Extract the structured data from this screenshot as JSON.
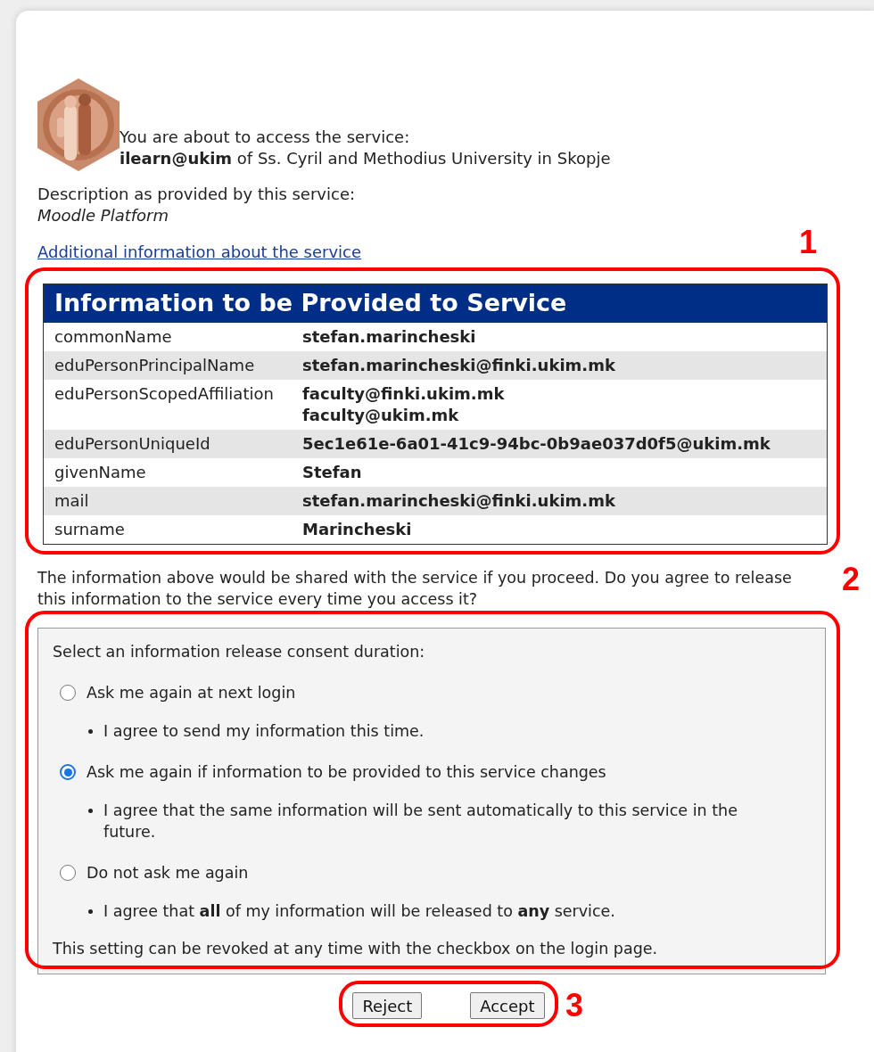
{
  "service": {
    "intro": "You are about to access the service:",
    "name_line": "**ilearn@ukim** of Ss. Cyril and Methodius University in Skopje",
    "description_label": "Description as provided by this service:",
    "description": "Moodle Platform",
    "info_link": "Additional information about the service"
  },
  "attributes": {
    "title": "Information to be Provided to Service",
    "rows": [
      {
        "name": "commonName",
        "values": [
          "stefan.marincheski"
        ]
      },
      {
        "name": "eduPersonPrincipalName",
        "values": [
          "stefan.marincheski@finki.ukim.mk"
        ]
      },
      {
        "name": "eduPersonScopedAffiliation",
        "values": [
          "faculty@finki.ukim.mk",
          "faculty@ukim.mk"
        ]
      },
      {
        "name": "eduPersonUniqueId",
        "values": [
          "5ec1e61e-6a01-41c9-94bc-0b9ae037d0f5@ukim.mk"
        ]
      },
      {
        "name": "givenName",
        "values": [
          "Stefan"
        ]
      },
      {
        "name": "mail",
        "values": [
          "stefan.marincheski@finki.ukim.mk"
        ]
      },
      {
        "name": "surname",
        "values": [
          "Marincheski"
        ]
      }
    ]
  },
  "notice": "The information above would be shared with the service if you proceed. Do you agree to release this information to the service every time you access it?",
  "consent": {
    "heading": "Select an information release consent duration:",
    "options": [
      {
        "label": "Ask me again at next login",
        "detail": "I agree to send my information this time.",
        "selected": false
      },
      {
        "label": "Ask me again if information to be provided to this service changes",
        "detail": "I agree that the same information will be sent automatically to this service in the future.",
        "selected": true
      },
      {
        "label": "Do not ask me again",
        "detail": "I agree that **all** of my information will be released to **any** service.",
        "selected": false
      }
    ],
    "footer": "This setting can be revoked at any time with the checkbox on the login page."
  },
  "buttons": [
    "Reject",
    "Accept"
  ],
  "annotations": [
    {
      "label": "1"
    },
    {
      "label": "2"
    },
    {
      "label": "3"
    }
  ]
}
